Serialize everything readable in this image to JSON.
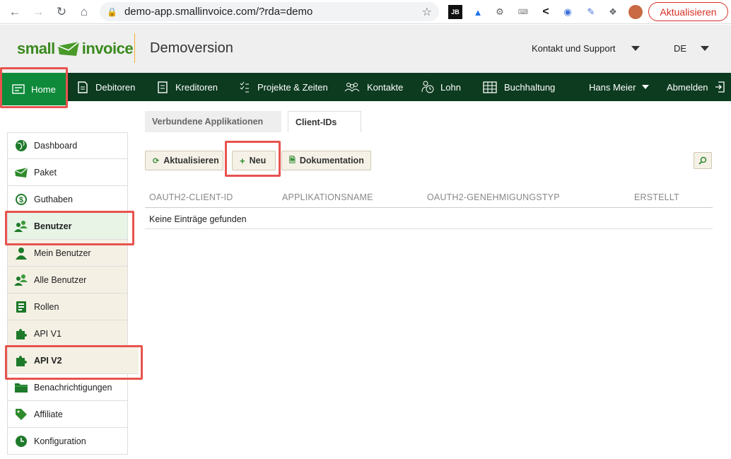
{
  "browser": {
    "url": "demo-app.smallinvoice.com/?rda=demo",
    "reload_label": "Aktualisieren"
  },
  "header": {
    "logo_word1": "small",
    "logo_word2": "invoice",
    "title": "Demoversion",
    "support_label": "Kontakt und Support",
    "language": "DE"
  },
  "nav": {
    "home": "Home",
    "debitoren": "Debitoren",
    "kreditoren": "Kreditoren",
    "projekte": "Projekte & Zeiten",
    "kontakte": "Kontakte",
    "lohn": "Lohn",
    "buchhaltung": "Buchhaltung",
    "user": "Hans Meier",
    "logout": "Abmelden"
  },
  "sidebar": {
    "items": [
      {
        "label": "Dashboard",
        "icon": "globe-icon"
      },
      {
        "label": "Paket",
        "icon": "envelope-icon"
      },
      {
        "label": "Guthaben",
        "icon": "dollar-icon"
      },
      {
        "label": "Benutzer",
        "icon": "users-icon"
      },
      {
        "label": "Mein Benutzer",
        "icon": "user-icon"
      },
      {
        "label": "Alle Benutzer",
        "icon": "users-icon"
      },
      {
        "label": "Rollen",
        "icon": "roles-icon"
      },
      {
        "label": "API V1",
        "icon": "puzzle-icon"
      },
      {
        "label": "API V2",
        "icon": "puzzle-icon"
      },
      {
        "label": "Benachrichtigungen",
        "icon": "folder-icon"
      },
      {
        "label": "Affiliate",
        "icon": "tag-icon"
      },
      {
        "label": "Konfiguration",
        "icon": "clock-icon"
      }
    ]
  },
  "tabs": {
    "connected_apps": "Verbundene Applikationen",
    "client_ids": "Client-IDs"
  },
  "toolbar": {
    "refresh": "Aktualisieren",
    "new": "Neu",
    "docs": "Dokumentation"
  },
  "table": {
    "headers": [
      "OAUTH2-CLIENT-ID",
      "APPLIKATIONSNAME",
      "OAUTH2-GENEHMIGUNGSTYP",
      "ERSTELLT"
    ],
    "empty_message": "Keine Einträge gefunden"
  },
  "colors": {
    "nav_bg": "#0c3b1f",
    "nav_active": "#0e8a3a",
    "highlight": "#e8534e",
    "brand_green": "#3a8a1e"
  }
}
